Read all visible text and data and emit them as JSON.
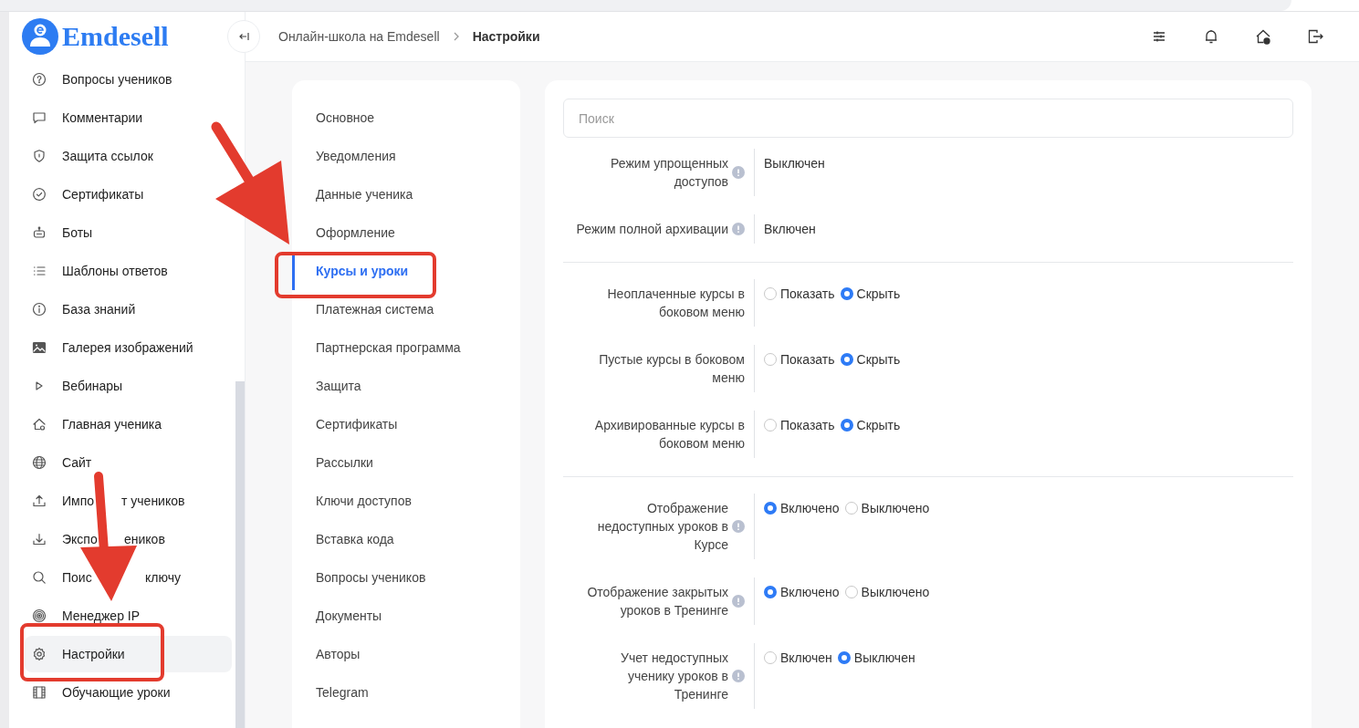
{
  "logo": {
    "text": "Emdesell"
  },
  "breadcrumbs": [
    {
      "label": "Онлайн-школа на Emdesell",
      "current": false
    },
    {
      "label": "Настройки",
      "current": true
    }
  ],
  "sidebar": {
    "items": [
      {
        "label": "Вопросы учеников",
        "selected": false
      },
      {
        "label": "Комментарии",
        "selected": false
      },
      {
        "label": "Защита ссылок",
        "selected": false
      },
      {
        "label": "Сертификаты",
        "selected": false
      },
      {
        "label": "Боты",
        "selected": false
      },
      {
        "label": "Шаблоны ответов",
        "selected": false
      },
      {
        "label": "База знаний",
        "selected": false
      },
      {
        "label": "Галерея изображений",
        "selected": false
      },
      {
        "label": "Вебинары",
        "selected": false
      },
      {
        "label": "Главная ученика",
        "selected": false
      },
      {
        "label": "Сайт",
        "selected": false
      },
      {
        "label": "Импо",
        "label_after_arrow": "т учеников",
        "selected": false
      },
      {
        "label": "Экспо",
        "label_after_arrow": "еников",
        "selected": false
      },
      {
        "label": "Поис",
        "label_after_arrow": "ключу",
        "selected": false
      },
      {
        "label": "Менеджер IP",
        "selected": false
      },
      {
        "label": "Настройки",
        "selected": true
      },
      {
        "label": "Обучающие уроки",
        "selected": false
      }
    ]
  },
  "settings_menu": [
    {
      "label": "Основное",
      "selected": false
    },
    {
      "label": "Уведомления",
      "selected": false
    },
    {
      "label": "Данные ученика",
      "selected": false
    },
    {
      "label": "Оформление",
      "selected": false
    },
    {
      "label": "Курсы и уроки",
      "selected": true
    },
    {
      "label": "Платежная система",
      "selected": false
    },
    {
      "label": "Партнерская программа",
      "selected": false
    },
    {
      "label": "Защита",
      "selected": false
    },
    {
      "label": "Сертификаты",
      "selected": false
    },
    {
      "label": "Рассылки",
      "selected": false
    },
    {
      "label": "Ключи доступов",
      "selected": false
    },
    {
      "label": "Вставка кода",
      "selected": false
    },
    {
      "label": "Вопросы учеников",
      "selected": false
    },
    {
      "label": "Документы",
      "selected": false
    },
    {
      "label": "Авторы",
      "selected": false
    },
    {
      "label": "Telegram",
      "selected": false
    }
  ],
  "search": {
    "placeholder": "Поиск"
  },
  "settings_groups": [
    {
      "rows": [
        {
          "label": "Режим упрощенных доступов",
          "info": true,
          "kind": "text",
          "value": "Выключен"
        },
        {
          "label": "Режим полной архивации",
          "info": true,
          "kind": "text",
          "value": "Включен"
        }
      ]
    },
    {
      "rows": [
        {
          "label": "Неоплаченные курсы в боковом меню",
          "info": false,
          "kind": "radio",
          "options": [
            {
              "label": "Показать",
              "selected": false
            },
            {
              "label": "Скрыть",
              "selected": true
            }
          ]
        },
        {
          "label": "Пустые курсы в боковом меню",
          "info": false,
          "kind": "radio",
          "options": [
            {
              "label": "Показать",
              "selected": false
            },
            {
              "label": "Скрыть",
              "selected": true
            }
          ]
        },
        {
          "label": "Архивированные курсы в боковом меню",
          "info": false,
          "kind": "radio",
          "options": [
            {
              "label": "Показать",
              "selected": false
            },
            {
              "label": "Скрыть",
              "selected": true
            }
          ]
        }
      ]
    },
    {
      "rows": [
        {
          "label": "Отображение недоступных уроков в Курсе",
          "info": true,
          "kind": "radio",
          "options": [
            {
              "label": "Включено",
              "selected": true
            },
            {
              "label": "Выключено",
              "selected": false
            }
          ]
        },
        {
          "label": "Отображение закрытых уроков в Тренинге",
          "info": true,
          "kind": "radio",
          "options": [
            {
              "label": "Включено",
              "selected": true
            },
            {
              "label": "Выключено",
              "selected": false
            }
          ]
        },
        {
          "label": "Учет недоступных ученику уроков в Тренинге",
          "info": true,
          "kind": "radio",
          "options": [
            {
              "label": "Включен",
              "selected": false
            },
            {
              "label": "Выключен",
              "selected": true
            }
          ]
        }
      ]
    }
  ]
}
